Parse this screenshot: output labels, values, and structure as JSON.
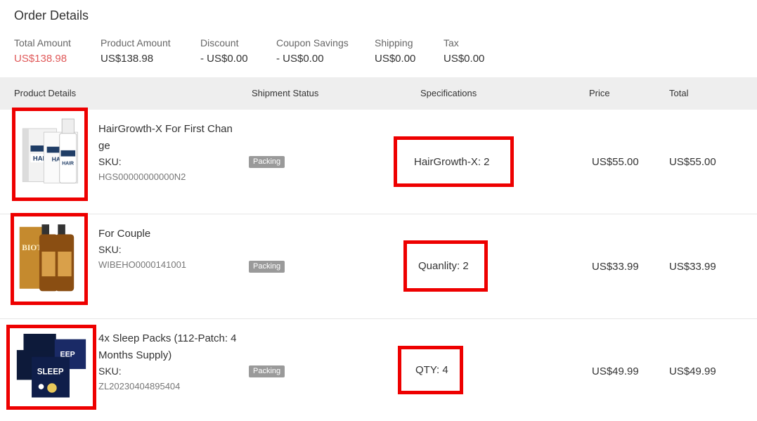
{
  "title": "Order Details",
  "summary": {
    "total_amount": {
      "label": "Total Amount",
      "value": "US$138.98"
    },
    "product_amount": {
      "label": "Product Amount",
      "value": "US$138.98"
    },
    "discount": {
      "label": "Discount",
      "value": "- US$0.00"
    },
    "coupon": {
      "label": "Coupon Savings",
      "value": "- US$0.00"
    },
    "shipping": {
      "label": "Shipping",
      "value": "US$0.00"
    },
    "tax": {
      "label": "Tax",
      "value": "US$0.00"
    }
  },
  "columns": {
    "product": "Product Details",
    "status": "Shipment Status",
    "spec": "Specifications",
    "price": "Price",
    "total": "Total"
  },
  "items": [
    {
      "name_line1": "HairGrowth-X For First Chan",
      "name_line2": "ge",
      "sku_label": "SKU:",
      "sku": "HGS00000000000N2",
      "status": "Packing",
      "spec": "HairGrowth-X: 2",
      "price": "US$55.00",
      "total": "US$55.00"
    },
    {
      "name_line1": "For Couple",
      "sku_label": "SKU:",
      "sku": "WIBEHO0000141001",
      "status": "Packing",
      "spec": "Quanlity: 2",
      "price": "US$33.99",
      "total": "US$33.99"
    },
    {
      "name_line1": "4x Sleep Packs (112-Patch: 4",
      "name_line2": "Months Supply)",
      "sku_label": "SKU:",
      "sku": "ZL20230404895404",
      "status": "Packing",
      "spec": "QTY: 4",
      "price": "US$49.99",
      "total": "US$49.99"
    }
  ],
  "colors": {
    "accent_red": "#e05a5a",
    "highlight_border": "#ee0000",
    "badge_bg": "#9a9a9a",
    "header_bg": "#eeeeee"
  },
  "thumbnail_names": [
    "hair-treatment-box-image",
    "biotin-spray-bottles-image",
    "sleep-patch-packs-image"
  ]
}
